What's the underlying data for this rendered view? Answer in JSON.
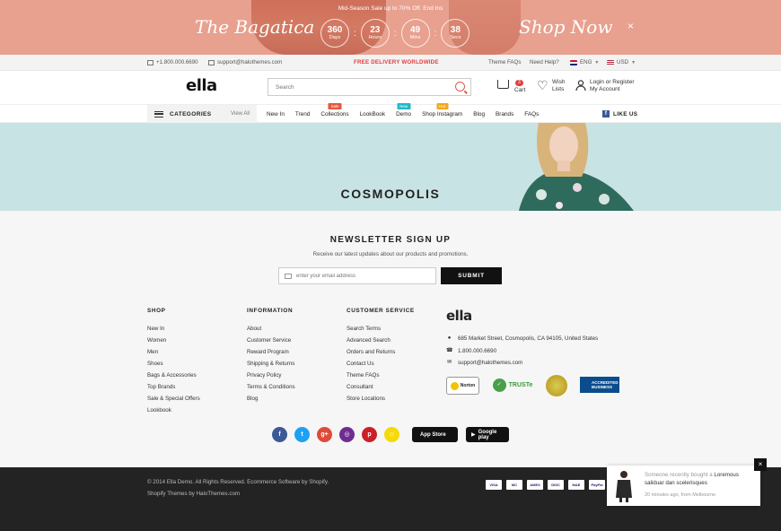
{
  "promo": {
    "subtitle": "Mid-Season Sale up to 70% Off. End Ins",
    "script_left": "The Bagatica",
    "script_right": "Shop Now",
    "countdown": [
      {
        "value": "360",
        "label": "Days"
      },
      {
        "value": "23",
        "label": "Hours"
      },
      {
        "value": "49",
        "label": "Mins"
      },
      {
        "value": "38",
        "label": "Secs"
      }
    ],
    "close": "×"
  },
  "topbar": {
    "phone": "+1.800.000.6690",
    "email": "support@halothemes.com",
    "free_delivery": "FREE DELIVERY WORLDWIDE",
    "theme_faqs": "Theme FAQs",
    "need_help": "Need Help?",
    "language": "ENG",
    "currency": "USD"
  },
  "header": {
    "logo": "ella",
    "search_placeholder": "Search",
    "cart_count": "3",
    "cart_label": "Cart",
    "wish_label": "Wish Lists",
    "login_label": "Login or Register",
    "account_label": "My Account"
  },
  "nav": {
    "categories": "CATEGORIES",
    "view_all": "View All",
    "links": [
      {
        "label": "New In",
        "badge": ""
      },
      {
        "label": "Trend",
        "badge": ""
      },
      {
        "label": "Collections",
        "badge": "Sale",
        "badge_color": "#e2563c"
      },
      {
        "label": "LookBook",
        "badge": ""
      },
      {
        "label": "Demo",
        "badge": "New",
        "badge_color": "#22b6c7"
      },
      {
        "label": "Shop Instagram",
        "badge": "Hot",
        "badge_color": "#f2a81c"
      },
      {
        "label": "Blog",
        "badge": ""
      },
      {
        "label": "Brands",
        "badge": ""
      },
      {
        "label": "FAQs",
        "badge": ""
      }
    ],
    "like_us": "LIKE US"
  },
  "hero": {
    "title": "COSMOPOLIS"
  },
  "newsletter": {
    "title": "NEWSLETTER SIGN UP",
    "subtitle": "Receive our latest updates about our products and promotions.",
    "placeholder": "enter your email address",
    "button": "SUBMIT"
  },
  "footer": {
    "shop": {
      "title": "SHOP",
      "links": [
        "New In",
        "Women",
        "Men",
        "Shoes",
        "Bags & Accessories",
        "Top Brands",
        "Sale & Special Offers",
        "Lookbook"
      ]
    },
    "information": {
      "title": "INFORMATION",
      "links": [
        "About",
        "Customer Service",
        "Reward Program",
        "Shipping & Returns",
        "Privacy Policy",
        "Terms & Conditions",
        "Blog"
      ]
    },
    "customer_service": {
      "title": "CUSTOMER SERVICE",
      "links": [
        "Search Terms",
        "Advanced Search",
        "Orders and Returns",
        "Contact Us",
        "Theme FAQs",
        "Consultant",
        "Store Locations"
      ]
    },
    "contact": {
      "logo": "ella",
      "address": "685 Market Street, Cosmopolis, CA 94105, United States",
      "phone": "1.800.000.6690",
      "email": "support@halothemes.com"
    },
    "trust": {
      "norton": "Norton",
      "truste": "TRUSTe",
      "bbb": "ACCREDITED BUSINESS"
    },
    "socials": [
      {
        "name": "facebook",
        "glyph": "f",
        "color": "#3b5998"
      },
      {
        "name": "twitter",
        "glyph": "t",
        "color": "#1da1f2"
      },
      {
        "name": "google-plus",
        "glyph": "g+",
        "color": "#dd4b39"
      },
      {
        "name": "instagram",
        "glyph": "◎",
        "color": "#6f2c91"
      },
      {
        "name": "pinterest",
        "glyph": "p",
        "color": "#cb2027"
      },
      {
        "name": "snapchat",
        "glyph": "☺",
        "color": "#f5d90a"
      }
    ],
    "app_store": "App Store",
    "google_play": "Google play"
  },
  "bottom": {
    "copyright": "© 2014 Ella Demo. All Rights Reserved. Ecommerce Software by Shopify.",
    "themes_by": "Shopify Themes by HaloThemes.com",
    "payments": [
      "VISA",
      "MC",
      "AMEX",
      "DISC",
      "MAE",
      "PayPal"
    ]
  },
  "toast": {
    "line1_muted": "Someone recently bought a",
    "product": "Loremous saliduar dan scelerisques",
    "time": "20 minutes ago, from Melbourne",
    "close": "×"
  }
}
